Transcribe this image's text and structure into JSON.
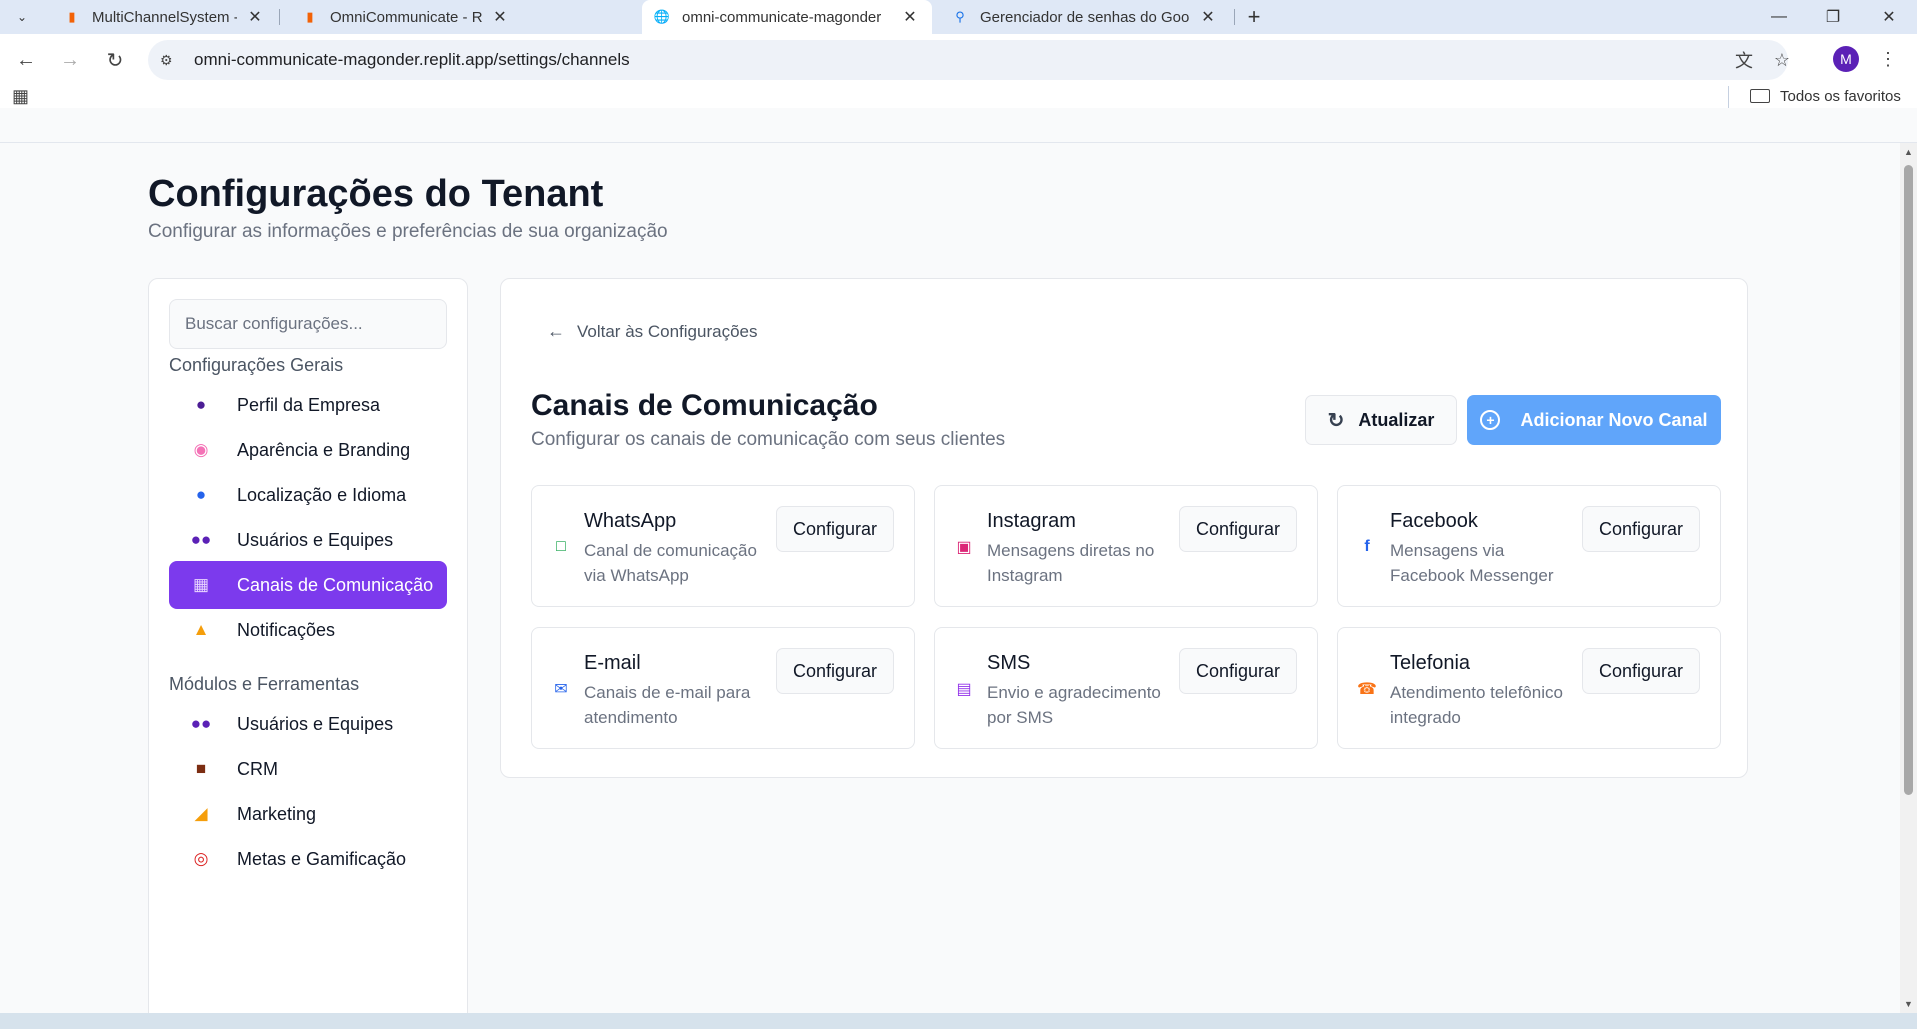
{
  "browser": {
    "tabs": [
      {
        "title": "MultiChannelSystem - Replit",
        "favicon": "replit-icon"
      },
      {
        "title": "OmniCommunicate - Replit",
        "favicon": "replit-icon"
      },
      {
        "title": "omni-communicate-magonder",
        "favicon": "globe-icon"
      },
      {
        "title": "Gerenciador de senhas do Goo",
        "favicon": "key-icon"
      }
    ],
    "url": "omni-communicate-magonder.replit.app/settings/channels",
    "profile_initial": "M",
    "bookmarks_label": "Todos os favoritos"
  },
  "page": {
    "title": "Configurações do Tenant",
    "subtitle": "Configurar as informações e preferências de sua organização"
  },
  "sidebar": {
    "search_placeholder": "Buscar configurações...",
    "general_label": "Configurações Gerais",
    "general_items": [
      {
        "label": "Perfil da Empresa",
        "icon": "person-icon",
        "color": "#4c1d95"
      },
      {
        "label": "Aparência e Branding",
        "icon": "palette-icon",
        "color": "#f472b6"
      },
      {
        "label": "Localização e Idioma",
        "icon": "globe-icon",
        "color": "#2563eb"
      },
      {
        "label": "Usuários e Equipes",
        "icon": "people-icon",
        "color": "#5b21b6"
      },
      {
        "label": "Canais de Comunicação",
        "icon": "phone-icon",
        "color": "#ffffff",
        "active": true
      },
      {
        "label": "Notificações",
        "icon": "bell-icon",
        "color": "#f59e0b"
      }
    ],
    "modules_label": "Módulos e Ferramentas",
    "module_items": [
      {
        "label": "Usuários e Equipes",
        "icon": "people-icon",
        "color": "#5b21b6"
      },
      {
        "label": "CRM",
        "icon": "briefcase-icon",
        "color": "#7c2d12"
      },
      {
        "label": "Marketing",
        "icon": "megaphone-icon",
        "color": "#f59e0b"
      },
      {
        "label": "Metas e Gamificação",
        "icon": "target-icon",
        "color": "#dc2626"
      }
    ]
  },
  "main": {
    "back_label": "Voltar às Configurações",
    "title": "Canais de Comunicação",
    "subtitle": "Configurar os canais de comunicação com seus clientes",
    "refresh_label": "Atualizar",
    "add_label": "Adicionar Novo Canal",
    "configure_label": "Configurar",
    "channels": [
      {
        "name": "WhatsApp",
        "description": "Canal de comunicação via WhatsApp",
        "icon": "chat-icon",
        "color": "#16a34a"
      },
      {
        "name": "Instagram",
        "description": "Mensagens diretas no Instagram",
        "icon": "instagram-icon",
        "color": "#db2777"
      },
      {
        "name": "Facebook",
        "description": "Mensagens via Facebook Messenger",
        "icon": "facebook-icon",
        "color": "#2563eb"
      },
      {
        "name": "E-mail",
        "description": "Canais de e-mail para atendimento",
        "icon": "mail-icon",
        "color": "#2563eb"
      },
      {
        "name": "SMS",
        "description": "Envio e agradecimento por SMS",
        "icon": "message-icon",
        "color": "#9333ea"
      },
      {
        "name": "Telefonia",
        "description": "Atendimento telefônico integrado",
        "icon": "phone-icon",
        "color": "#f97316"
      }
    ]
  },
  "colors": {
    "accent": "#7c3aed",
    "primary_button": "#60a5fa"
  }
}
